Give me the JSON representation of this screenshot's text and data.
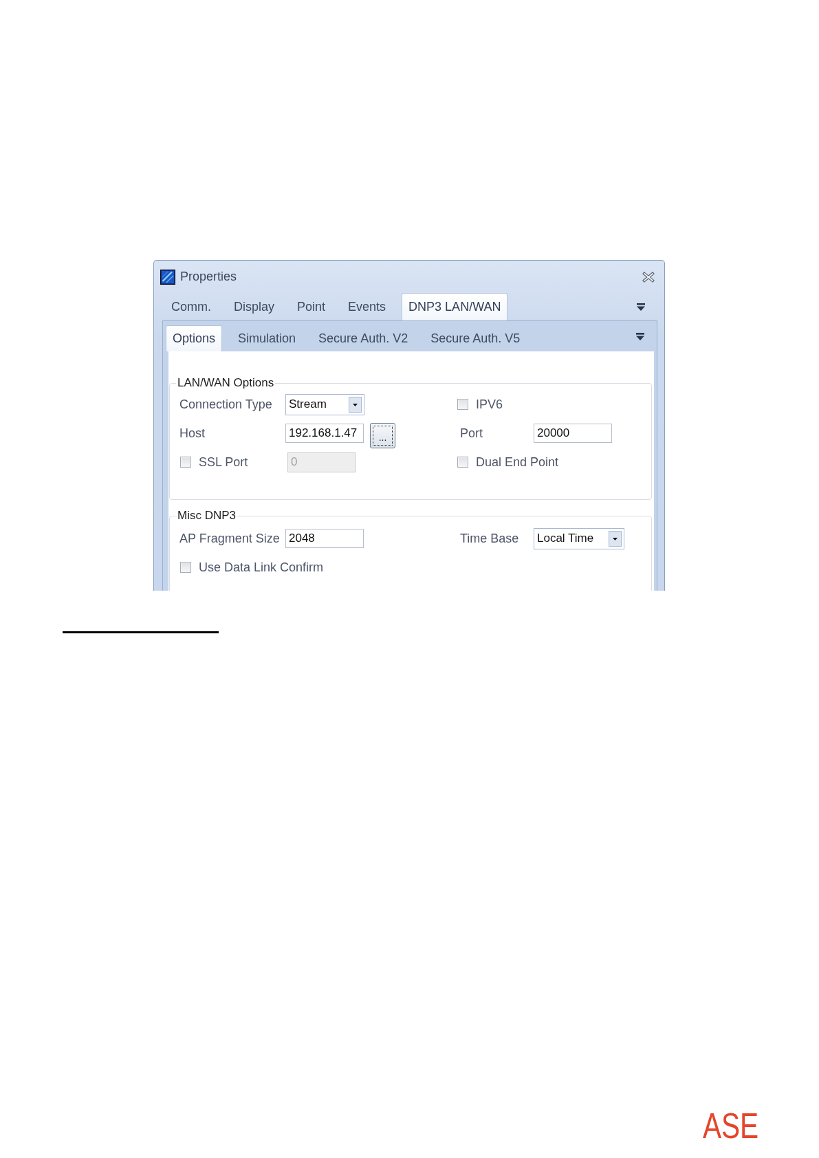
{
  "window": {
    "title": "Properties"
  },
  "tabs": [
    {
      "label": "Comm.",
      "selected": false
    },
    {
      "label": "Display",
      "selected": false
    },
    {
      "label": "Point",
      "selected": false
    },
    {
      "label": "Events",
      "selected": false
    },
    {
      "label": "DNP3 LAN/WAN",
      "selected": true
    }
  ],
  "subtabs": [
    {
      "label": "Options",
      "selected": true
    },
    {
      "label": "Simulation",
      "selected": false
    },
    {
      "label": "Secure Auth. V2",
      "selected": false
    },
    {
      "label": "Secure Auth. V5",
      "selected": false
    }
  ],
  "groups": [
    {
      "title": "LAN/WAN Options",
      "left": [
        {
          "kind": "dropdown",
          "label": "Connection Type",
          "value": "Stream"
        },
        {
          "kind": "text",
          "label": "Host",
          "value": "192.168.1.47",
          "disabled": false,
          "button": "..."
        },
        {
          "kind": "checkbox_text",
          "label": "SSL Port",
          "checked": false,
          "value": "0",
          "disabled": true
        }
      ],
      "right": [
        {
          "kind": "checkbox",
          "label": "IPV6",
          "checked": false
        },
        {
          "kind": "text",
          "label": "Port",
          "value": "20000",
          "disabled": false
        },
        {
          "kind": "checkbox",
          "label": "Dual End Point",
          "checked": false
        }
      ]
    },
    {
      "title": "Misc DNP3",
      "left": [
        {
          "kind": "text",
          "label": "AP Fragment Size",
          "value": "2048",
          "disabled": false
        },
        {
          "kind": "checkbox",
          "label": "Use Data Link Confirm",
          "checked": false
        }
      ],
      "right": [
        {
          "kind": "dropdown",
          "label": "Time Base",
          "value": "Local Time"
        }
      ]
    }
  ],
  "logo": {
    "text": "ASE"
  }
}
